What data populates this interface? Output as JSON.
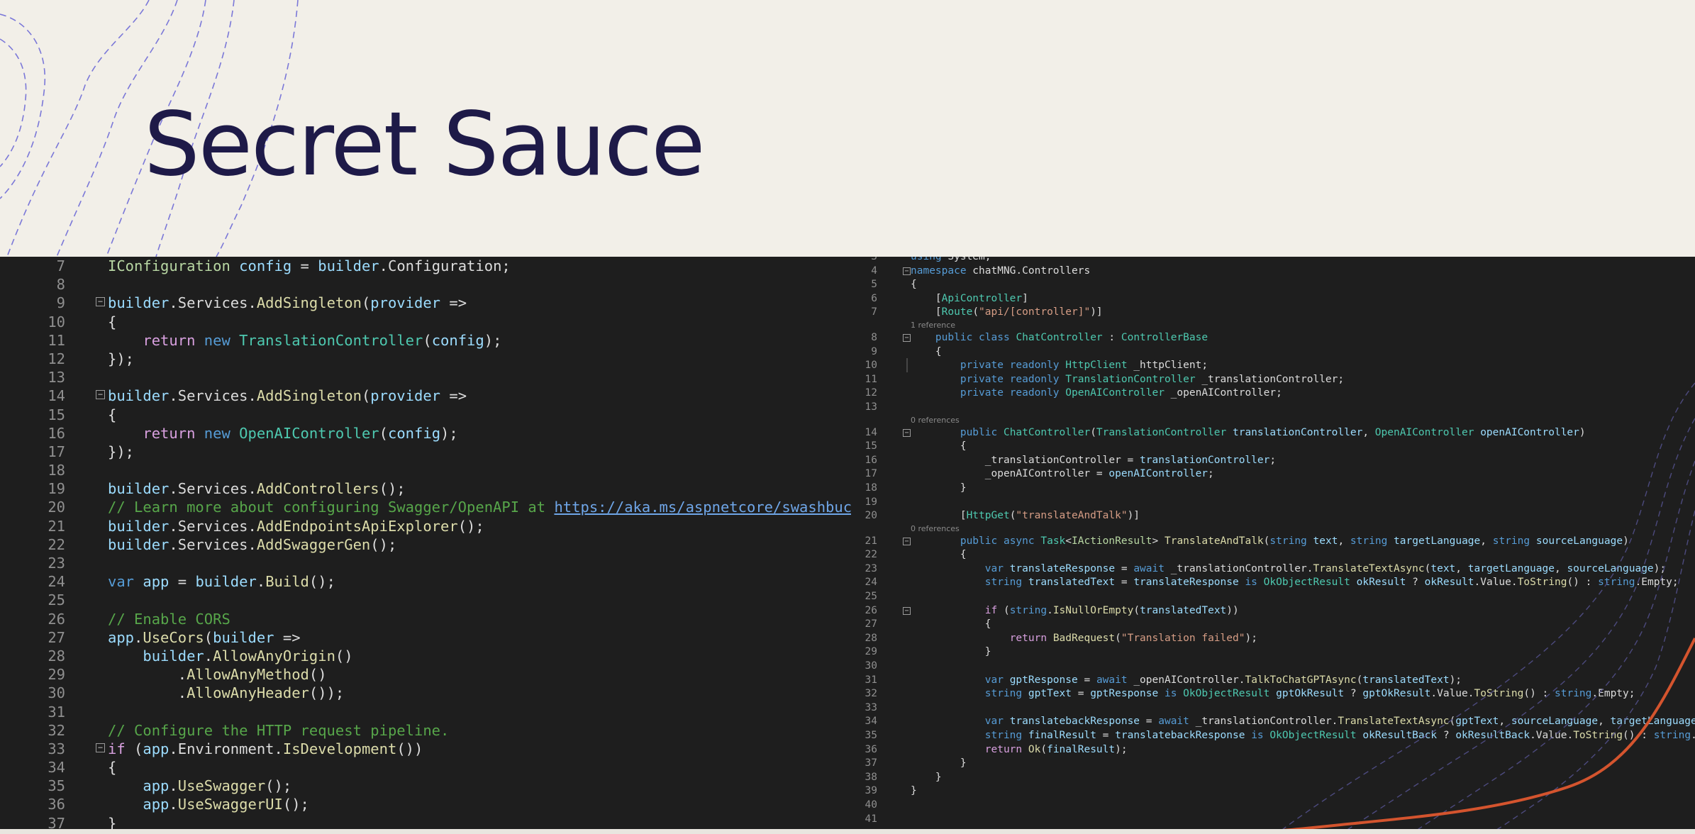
{
  "slide": {
    "title": "Secret Sauce"
  },
  "colors": {
    "background": "#f2efe8",
    "title": "#1e1a48",
    "editor_bg": "#1e1e1e",
    "decor_line": "#7b78d8",
    "accent_curve": "#d4542e"
  },
  "left_editor": {
    "lines": [
      {
        "n": "7",
        "fold": false,
        "html": "<span class=\"i\">IConfiguration</span> <span class=\"v\">config</span> = <span class=\"v\">builder</span>.Configuration;"
      },
      {
        "n": "8",
        "fold": false,
        "html": ""
      },
      {
        "n": "9",
        "fold": true,
        "html": "<span class=\"v\">builder</span>.Services.<span class=\"m\">AddSingleton</span>(<span class=\"v\">provider</span> =&gt;"
      },
      {
        "n": "10",
        "fold": false,
        "html": "{"
      },
      {
        "n": "11",
        "fold": false,
        "html": "    <span class=\"c\">return</span> <span class=\"k\">new</span> <span class=\"t\">TranslationController</span>(<span class=\"v\">config</span>);"
      },
      {
        "n": "12",
        "fold": false,
        "html": "});"
      },
      {
        "n": "13",
        "fold": false,
        "html": ""
      },
      {
        "n": "14",
        "fold": true,
        "html": "<span class=\"v\">builder</span>.Services.<span class=\"m\">AddSingleton</span>(<span class=\"v\">provider</span> =&gt;"
      },
      {
        "n": "15",
        "fold": false,
        "html": "{"
      },
      {
        "n": "16",
        "fold": false,
        "html": "    <span class=\"c\">return</span> <span class=\"k\">new</span> <span class=\"t\">OpenAIController</span>(<span class=\"v\">config</span>);"
      },
      {
        "n": "17",
        "fold": false,
        "html": "});"
      },
      {
        "n": "18",
        "fold": false,
        "html": ""
      },
      {
        "n": "19",
        "fold": false,
        "html": "<span class=\"v\">builder</span>.Services.<span class=\"m\">AddControllers</span>();"
      },
      {
        "n": "20",
        "fold": false,
        "html": "<span class=\"g\">// Learn more about configuring Swagger/OpenAPI at </span><span class=\"u\">https://aka.ms/aspnetcore/swashbuckle</span>"
      },
      {
        "n": "21",
        "fold": false,
        "html": "<span class=\"v\">builder</span>.Services.<span class=\"m\">AddEndpointsApiExplorer</span>();"
      },
      {
        "n": "22",
        "fold": false,
        "html": "<span class=\"v\">builder</span>.Services.<span class=\"m\">AddSwaggerGen</span>();"
      },
      {
        "n": "23",
        "fold": false,
        "html": ""
      },
      {
        "n": "24",
        "fold": false,
        "html": "<span class=\"k\">var</span> <span class=\"v\">app</span> = <span class=\"v\">builder</span>.<span class=\"m\">Build</span>();"
      },
      {
        "n": "25",
        "fold": false,
        "html": ""
      },
      {
        "n": "26",
        "fold": false,
        "html": "<span class=\"g\">// Enable CORS</span>"
      },
      {
        "n": "27",
        "fold": false,
        "html": "<span class=\"v\">app</span>.<span class=\"m\">UseCors</span>(<span class=\"v\">builder</span> =&gt;"
      },
      {
        "n": "28",
        "fold": false,
        "html": "    <span class=\"v\">builder</span>.<span class=\"m\">AllowAnyOrigin</span>()"
      },
      {
        "n": "29",
        "fold": false,
        "html": "        .<span class=\"m\">AllowAnyMethod</span>()"
      },
      {
        "n": "30",
        "fold": false,
        "html": "        .<span class=\"m\">AllowAnyHeader</span>());"
      },
      {
        "n": "31",
        "fold": false,
        "html": ""
      },
      {
        "n": "32",
        "fold": false,
        "html": "<span class=\"g\">// Configure the HTTP request pipeline.</span>"
      },
      {
        "n": "33",
        "fold": true,
        "html": "<span class=\"c\">if</span> (<span class=\"v\">app</span>.Environment.<span class=\"m\">IsDevelopment</span>())"
      },
      {
        "n": "34",
        "fold": false,
        "html": "{"
      },
      {
        "n": "35",
        "fold": false,
        "html": "    <span class=\"v\">app</span>.<span class=\"m\">UseSwagger</span>();"
      },
      {
        "n": "36",
        "fold": false,
        "html": "    <span class=\"v\">app</span>.<span class=\"m\">UseSwaggerUI</span>();"
      },
      {
        "n": "37",
        "fold": false,
        "html": "}"
      }
    ]
  },
  "right_editor": {
    "lines": [
      {
        "n": "3",
        "fold": false,
        "html": "<span class=\"k\">using</span> System;"
      },
      {
        "n": "4",
        "fold": true,
        "html": "<span class=\"k\">namespace</span> chatMNG.Controllers"
      },
      {
        "n": "5",
        "fold": false,
        "html": "{"
      },
      {
        "n": "6",
        "fold": false,
        "html": "    [<span class=\"t\">ApiController</span>]"
      },
      {
        "n": "7",
        "fold": false,
        "html": "    [<span class=\"t\">Route</span>(<span class=\"s\">\"api/[controller]\"</span>)]"
      },
      {
        "lens": true,
        "html": "1 reference"
      },
      {
        "n": "8",
        "fold": true,
        "html": "    <span class=\"k\">public</span> <span class=\"k\">class</span> <span class=\"t\">ChatController</span> : <span class=\"t\">ControllerBase</span>"
      },
      {
        "n": "9",
        "fold": false,
        "html": "    {"
      },
      {
        "n": "10",
        "fold": false,
        "current": true,
        "html": "        <span class=\"k\">private</span> <span class=\"k\">readonly</span> <span class=\"t\">HttpClient</span> _httpClient;"
      },
      {
        "n": "11",
        "fold": false,
        "html": "        <span class=\"k\">private</span> <span class=\"k\">readonly</span> <span class=\"t\">TranslationController</span> _translationController;"
      },
      {
        "n": "12",
        "fold": false,
        "html": "        <span class=\"k\">private</span> <span class=\"k\">readonly</span> <span class=\"t\">OpenAIController</span> _openAIController;"
      },
      {
        "n": "13",
        "fold": false,
        "html": ""
      },
      {
        "lens": true,
        "html": "0 references"
      },
      {
        "n": "14",
        "fold": true,
        "html": "        <span class=\"k\">public</span> <span class=\"t\">ChatController</span>(<span class=\"t\">TranslationController</span> <span class=\"v\">translationController</span>, <span class=\"t\">OpenAIController</span> <span class=\"v\">openAIController</span>)"
      },
      {
        "n": "15",
        "fold": false,
        "html": "        {"
      },
      {
        "n": "16",
        "fold": false,
        "html": "            _translationController = <span class=\"v\">translationController</span>;"
      },
      {
        "n": "17",
        "fold": false,
        "html": "            _openAIController = <span class=\"v\">openAIController</span>;"
      },
      {
        "n": "18",
        "fold": false,
        "html": "        }"
      },
      {
        "n": "19",
        "fold": false,
        "html": ""
      },
      {
        "n": "20",
        "fold": false,
        "html": "        [<span class=\"t\">HttpGet</span>(<span class=\"s\">\"translateAndTalk\"</span>)]"
      },
      {
        "lens": true,
        "html": "0 references"
      },
      {
        "n": "21",
        "fold": true,
        "html": "        <span class=\"k\">public</span> <span class=\"k\">async</span> <span class=\"t\">Task</span>&lt;<span class=\"i\">IActionResult</span>&gt; <span class=\"m\">TranslateAndTalk</span>(<span class=\"k\">string</span> <span class=\"v\">text</span>, <span class=\"k\">string</span> <span class=\"v\">targetLanguage</span>, <span class=\"k\">string</span> <span class=\"v\">sourceLanguage</span>)"
      },
      {
        "n": "22",
        "fold": false,
        "html": "        {"
      },
      {
        "n": "23",
        "fold": false,
        "html": "            <span class=\"k\">var</span> <span class=\"v\">translateResponse</span> = <span class=\"k\">await</span> _translationController.<span class=\"m\">TranslateTextAsync</span>(<span class=\"v\">text</span>, <span class=\"v\">targetLanguage</span>, <span class=\"v\">sourceLanguage</span>);"
      },
      {
        "n": "24",
        "fold": false,
        "html": "            <span class=\"k\">string</span> <span class=\"v\">translatedText</span> = <span class=\"v\">translateResponse</span> <span class=\"k\">is</span> <span class=\"t\">OkObjectResult</span> <span class=\"v\">okResult</span> ? <span class=\"v\">okResult</span>.Value.<span class=\"m\">ToString</span>() : <span class=\"k\">string</span>.Empty;"
      },
      {
        "n": "25",
        "fold": false,
        "html": ""
      },
      {
        "n": "26",
        "fold": true,
        "html": "            <span class=\"c\">if</span> (<span class=\"k\">string</span>.<span class=\"m\">IsNullOrEmpty</span>(<span class=\"v\">translatedText</span>))"
      },
      {
        "n": "27",
        "fold": false,
        "html": "            {"
      },
      {
        "n": "28",
        "fold": false,
        "html": "                <span class=\"c\">return</span> <span class=\"m\">BadRequest</span>(<span class=\"s\">\"Translation failed\"</span>);"
      },
      {
        "n": "29",
        "fold": false,
        "html": "            }"
      },
      {
        "n": "30",
        "fold": false,
        "html": ""
      },
      {
        "n": "31",
        "fold": false,
        "html": "            <span class=\"k\">var</span> <span class=\"v\">gptResponse</span> = <span class=\"k\">await</span> _openAIController.<span class=\"m\">TalkToChatGPTAsync</span>(<span class=\"v\">translatedText</span>);"
      },
      {
        "n": "32",
        "fold": false,
        "html": "            <span class=\"k\">string</span> <span class=\"v\">gptText</span> = <span class=\"v\">gptResponse</span> <span class=\"k\">is</span> <span class=\"t\">OkObjectResult</span> <span class=\"v\">gptOkResult</span> ? <span class=\"v\">gptOkResult</span>.Value.<span class=\"m\">ToString</span>() : <span class=\"k\">string</span>.Empty;"
      },
      {
        "n": "33",
        "fold": false,
        "html": ""
      },
      {
        "n": "34",
        "fold": false,
        "html": "            <span class=\"k\">var</span> <span class=\"v\">translatebackResponse</span> = <span class=\"k\">await</span> _translationController.<span class=\"m\">TranslateTextAsync</span>(<span class=\"v\">gptText</span>, <span class=\"v\">sourceLanguage</span>, <span class=\"v\">targetLanguage</span>);"
      },
      {
        "n": "35",
        "fold": false,
        "html": "            <span class=\"k\">string</span> <span class=\"v\">finalResult</span> = <span class=\"v\">translatebackResponse</span> <span class=\"k\">is</span> <span class=\"t\">OkObjectResult</span> <span class=\"v\">okResultBack</span> ? <span class=\"v\">okResultBack</span>.Value.<span class=\"m\">ToString</span>() : <span class=\"k\">string</span>.Empty;"
      },
      {
        "n": "36",
        "fold": false,
        "html": "            <span class=\"c\">return</span> <span class=\"m\">Ok</span>(<span class=\"v\">finalResult</span>);"
      },
      {
        "n": "37",
        "fold": false,
        "html": "        }"
      },
      {
        "n": "38",
        "fold": false,
        "html": "    }"
      },
      {
        "n": "39",
        "fold": false,
        "html": "}"
      },
      {
        "n": "40",
        "fold": false,
        "html": ""
      },
      {
        "n": "41",
        "fold": false,
        "html": ""
      }
    ]
  }
}
